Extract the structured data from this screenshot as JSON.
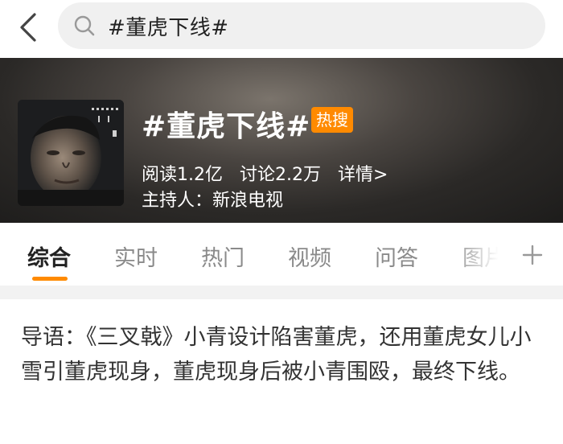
{
  "search": {
    "query": "#董虎下线#"
  },
  "topic": {
    "title": "#董虎下线#",
    "hot_badge": "热搜",
    "read": "阅读1.2亿",
    "discuss": "讨论2.2万",
    "details": "详情>",
    "host": "主持人：新浪电视"
  },
  "tabs": [
    {
      "label": "综合"
    },
    {
      "label": "实时"
    },
    {
      "label": "热门"
    },
    {
      "label": "视频"
    },
    {
      "label": "问答"
    },
    {
      "label": "图片"
    }
  ],
  "intro": {
    "text": "导语：《三叉戟》小青设计陷害董虎，还用董虎女儿小雪引董虎现身，董虎现身后被小青围殴，最终下线。"
  },
  "colors": {
    "accent": "#ff8a00",
    "hero_dark": "#1d1c1b"
  }
}
